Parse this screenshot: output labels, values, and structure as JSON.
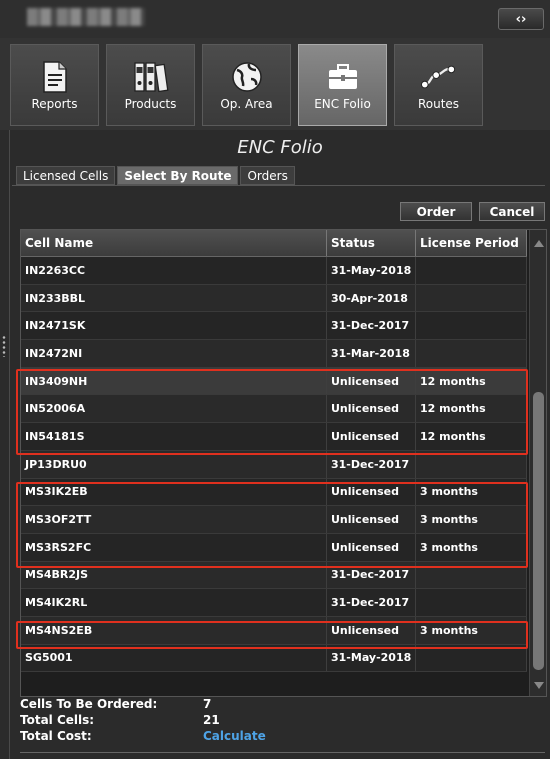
{
  "window": {
    "collapse_icon": "‹›"
  },
  "toolbar": {
    "items": [
      {
        "label": "Reports",
        "icon": "document-icon"
      },
      {
        "label": "Products",
        "icon": "binders-icon"
      },
      {
        "label": "Op. Area",
        "icon": "globe-icon"
      },
      {
        "label": "ENC Folio",
        "icon": "briefcase-icon",
        "active": true
      },
      {
        "label": "Routes",
        "icon": "route-icon"
      }
    ]
  },
  "panel": {
    "title": "ENC Folio",
    "tabs": [
      "Licensed Cells",
      "Select By Route",
      "Orders"
    ],
    "active_tab": "Select By Route",
    "order_label": "Order",
    "cancel_label": "Cancel"
  },
  "grid": {
    "columns": [
      "Cell Name",
      "Status",
      "License Period"
    ],
    "rows": [
      {
        "name": "IN2263CC",
        "status": "31-May-2018",
        "period": ""
      },
      {
        "name": "IN233BBL",
        "status": "30-Apr-2018",
        "period": ""
      },
      {
        "name": "IN2471SK",
        "status": "31-Dec-2017",
        "period": ""
      },
      {
        "name": "IN2472NI",
        "status": "31-Mar-2018",
        "period": ""
      },
      {
        "name": "IN3409NH",
        "status": "Unlicensed",
        "period": "12 months"
      },
      {
        "name": "IN52006A",
        "status": "Unlicensed",
        "period": "12 months"
      },
      {
        "name": "IN54181S",
        "status": "Unlicensed",
        "period": "12 months"
      },
      {
        "name": "JP13DRU0",
        "status": "31-Dec-2017",
        "period": ""
      },
      {
        "name": "MS3IK2EB",
        "status": "Unlicensed",
        "period": "3 months"
      },
      {
        "name": "MS3OF2TT",
        "status": "Unlicensed",
        "period": "3 months"
      },
      {
        "name": "MS3RS2FC",
        "status": "Unlicensed",
        "period": "3 months"
      },
      {
        "name": "MS4BR2JS",
        "status": "31-Dec-2017",
        "period": ""
      },
      {
        "name": "MS4IK2RL",
        "status": "31-Dec-2017",
        "period": ""
      },
      {
        "name": "MS4NS2EB",
        "status": "Unlicensed",
        "period": "3 months"
      },
      {
        "name": "SG5001",
        "status": "31-May-2018",
        "period": ""
      }
    ]
  },
  "summary": {
    "cells_to_order_label": "Cells To Be Ordered:",
    "cells_to_order_value": "7",
    "total_cells_label": "Total Cells:",
    "total_cells_value": "21",
    "total_cost_label": "Total Cost:",
    "total_cost_value": "Calculate"
  },
  "colors": {
    "highlight_box": "#e0301e",
    "link": "#4ea3e6"
  }
}
